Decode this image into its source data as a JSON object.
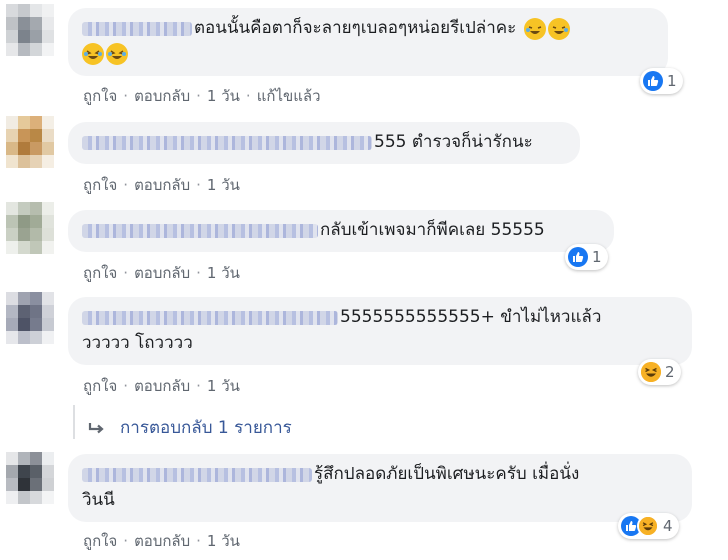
{
  "comments": [
    {
      "id": 1,
      "text_line1": "ตอนนั้นคือตาก็จะลายๆเบลอๆหน่อยรีเปล่าคะ",
      "text_line2": "",
      "like_label": "ถูกใจ",
      "reply_label": "ตอบกลับ",
      "time": "1 วัน",
      "edited": "แก้ไขแล้ว",
      "reaction_count": "1",
      "reactions": [
        "like-icon"
      ]
    },
    {
      "id": 2,
      "text_line1": "555 ตำรวจก็น่ารักนะ",
      "text_line2": "",
      "like_label": "ถูกใจ",
      "reply_label": "ตอบกลับ",
      "time": "1 วัน",
      "reaction_count": "",
      "reactions": []
    },
    {
      "id": 3,
      "text_line1": "กลับเข้าเพจมาก็พีคเลย 55555",
      "text_line2": "",
      "like_label": "ถูกใจ",
      "reply_label": "ตอบกลับ",
      "time": "1 วัน",
      "reaction_count": "1",
      "reactions": [
        "like-icon"
      ]
    },
    {
      "id": 4,
      "text_line1": "5555555555555+ ขำไม่ไหวแล้ว",
      "text_line2": "ววววว โถวววว",
      "like_label": "ถูกใจ",
      "reply_label": "ตอบกลับ",
      "time": "1 วัน",
      "reaction_count": "2",
      "reactions": [
        "haha-icon"
      ]
    },
    {
      "id": 5,
      "text_line1": "รู้สึกปลอดภัยเป็นพิเศษนะครับ เมื่อนั่ง",
      "text_line2": "วินนี",
      "like_label": "ถูกใจ",
      "reply_label": "ตอบกลับ",
      "time": "1 วัน",
      "reaction_count": "4",
      "reactions": [
        "like-icon",
        "haha-icon"
      ]
    }
  ],
  "replies_link": {
    "label": "การตอบกลับ 1 รายการ",
    "icon": "reply-arrow-icon"
  },
  "colors": {
    "bubble": "#f2f3f5",
    "link": "#385898",
    "like": "#1877f2",
    "haha": "#f7b125",
    "meta": "#606770"
  }
}
